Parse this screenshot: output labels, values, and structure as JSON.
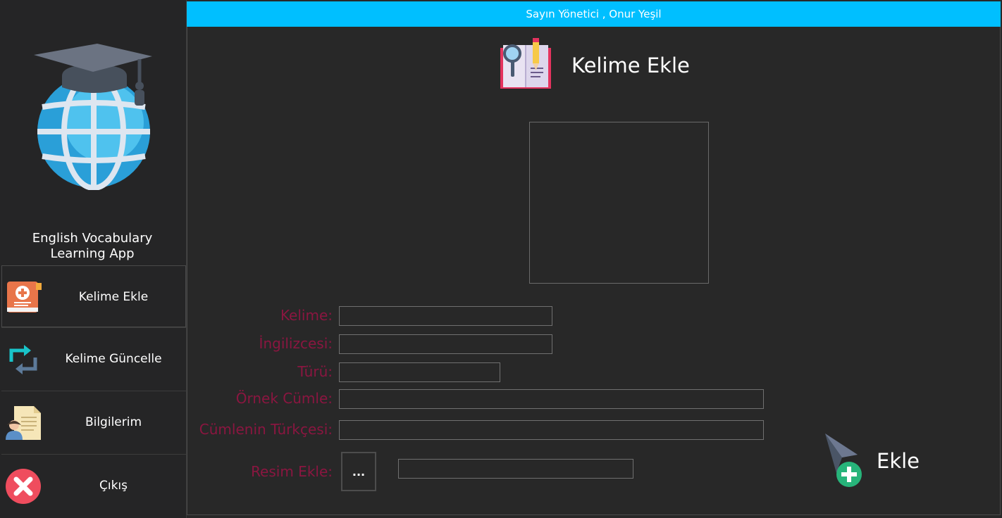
{
  "header": {
    "greeting": "Sayın Yönetici , Onur Yeşil"
  },
  "sidebar": {
    "app_title_line1": "English Vocabulary",
    "app_title_line2": "Learning App",
    "logo_icon": "graduation-globe-icon",
    "items": [
      {
        "label": "Kelime Ekle",
        "icon": "add-book-icon",
        "active": true
      },
      {
        "label": "Kelime Güncelle",
        "icon": "refresh-arrows-icon"
      },
      {
        "label": "Bilgilerim",
        "icon": "profile-document-icon"
      },
      {
        "label": "Çıkış",
        "icon": "close-circle-icon"
      }
    ]
  },
  "main": {
    "title": "Kelime Ekle",
    "title_icon": "dictionary-search-icon",
    "form": {
      "word_label": "Kelime:",
      "english_label": "İngilizcesi:",
      "type_label": "Türü:",
      "example_label": "Örnek Cümle:",
      "translation_label": "Cümlenin Türkçesi:",
      "image_label": "Resim Ekle:",
      "word_value": "",
      "english_value": "",
      "type_value": "",
      "example_value": "",
      "translation_value": "",
      "image_path_value": "",
      "browse_label": "...",
      "submit_label": "Ekle"
    }
  },
  "colors": {
    "accent": "#00bfff",
    "background": "#282828",
    "sidebar": "#252526",
    "label": "#8a1640",
    "text": "#ffffff"
  }
}
